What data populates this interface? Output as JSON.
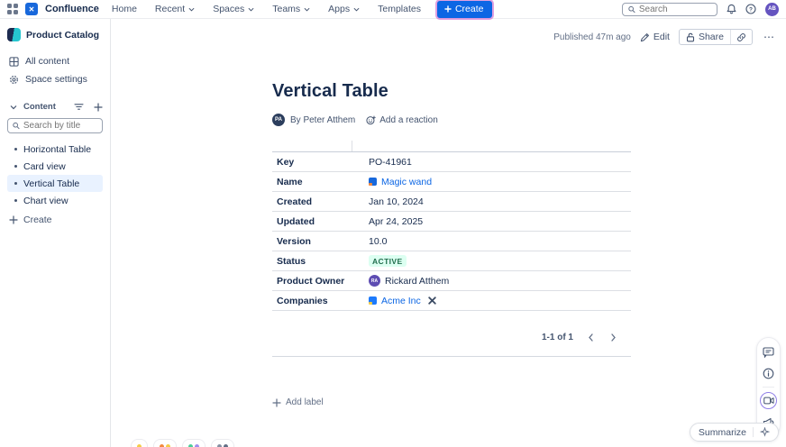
{
  "topbar": {
    "product_name": "Confluence",
    "nav_items": [
      {
        "label": "Home",
        "chevron": false
      },
      {
        "label": "Recent",
        "chevron": true
      },
      {
        "label": "Spaces",
        "chevron": true
      },
      {
        "label": "Teams",
        "chevron": true
      },
      {
        "label": "Apps",
        "chevron": true
      },
      {
        "label": "Templates",
        "chevron": false
      }
    ],
    "create_label": "Create",
    "search_placeholder": "Search",
    "avatar_initials": "AB"
  },
  "sidebar": {
    "space_name": "Product Catalog",
    "links": {
      "all_content": "All content",
      "space_settings": "Space settings"
    },
    "content_section_title": "Content",
    "search_placeholder": "Search by title",
    "pages": [
      {
        "label": "Horizontal Table",
        "selected": false
      },
      {
        "label": "Card view",
        "selected": false
      },
      {
        "label": "Vertical Table",
        "selected": true
      },
      {
        "label": "Chart view",
        "selected": false
      }
    ],
    "create_label": "Create"
  },
  "page_header": {
    "published": "Published 47m ago",
    "edit_label": "Edit",
    "share_label": "Share",
    "more_label": "⋯"
  },
  "page": {
    "title": "Vertical Table",
    "byline_avatar": "PA",
    "byline": "By Peter Atthem",
    "add_reaction_label": "Add a reaction",
    "table": {
      "rows": [
        {
          "label": "Key",
          "value": "PO-41961",
          "type": "text"
        },
        {
          "label": "Name",
          "value": "Magic wand",
          "type": "link"
        },
        {
          "label": "Created",
          "value": "Jan 10, 2024",
          "type": "text"
        },
        {
          "label": "Updated",
          "value": "Apr 24, 2025",
          "type": "text"
        },
        {
          "label": "Version",
          "value": "10.0",
          "type": "text"
        },
        {
          "label": "Status",
          "value": "ACTIVE",
          "type": "badge"
        },
        {
          "label": "Product Owner",
          "value": "Rickard Atthem",
          "type": "user",
          "avatar": "RA"
        },
        {
          "label": "Companies",
          "value": "Acme Inc",
          "type": "company-link"
        }
      ]
    },
    "pagination": {
      "label": "1-1 of 1"
    },
    "add_label": "Add label"
  },
  "reactions": [
    {
      "dots": [
        "#F5CD47"
      ]
    },
    {
      "dots": [
        "#F38A3F",
        "#F5CD47"
      ]
    },
    {
      "dots": [
        "#4BCE97",
        "#9F8FEF"
      ]
    },
    {
      "dots": [
        "#8590A2",
        "#626F86"
      ]
    }
  ],
  "summarize_label": "Summarize",
  "colors": {
    "accent_blue": "#0C66E4",
    "link_blue": "#0C66E4",
    "badge_bg": "#DCFFF1",
    "badge_text": "#216E4E",
    "selected_item_bg": "#E9F2FF",
    "avatar_purple": "#6554C0",
    "owner_avatar_purple": "#5E4DB2",
    "byline_avatar_navy": "#2C3E5D",
    "loom_ring": "#8F7EE7",
    "create_focus_ring": "#C652C6"
  }
}
